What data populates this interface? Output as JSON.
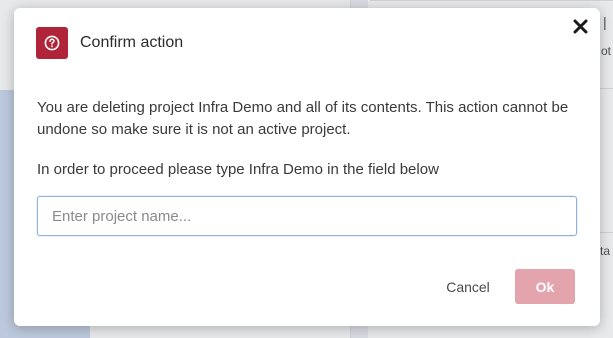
{
  "background": {
    "right_fragment_top": "ot",
    "right_fragment_mid": "ta",
    "right_fragment_corner": "|"
  },
  "dialog": {
    "title": "Confirm action",
    "header_icon": "question-circle-icon",
    "close_icon": "close-x-icon",
    "accent_color": "#b0243a",
    "message": "You are deleting project Infra Demo and all of its contents. This action cannot be undone so make sure it is not an active project.",
    "instruction": "In order to proceed please type Infra Demo in the field below",
    "input": {
      "value": "",
      "placeholder": "Enter project name..."
    },
    "buttons": {
      "cancel_label": "Cancel",
      "ok_label": "Ok",
      "ok_color_disabled": "#e4a4ad"
    }
  }
}
